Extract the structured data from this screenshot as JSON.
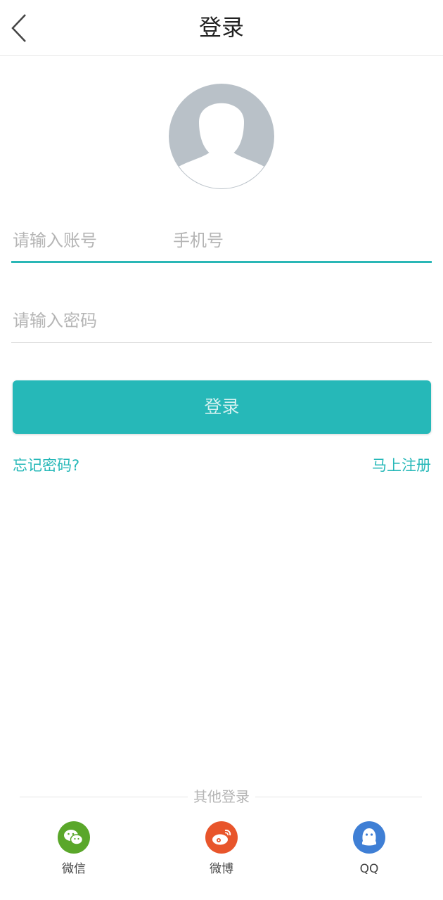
{
  "header": {
    "title": "登录",
    "back_icon": "chevron-left-icon"
  },
  "avatar": {
    "icon": "default-user-avatar-icon"
  },
  "account": {
    "placeholder": "请输入账号",
    "hint": "手机号"
  },
  "password": {
    "placeholder": "请输入密码"
  },
  "login_button": "登录",
  "links": {
    "forgot": "忘记密码?",
    "register": "马上注册"
  },
  "other_login": {
    "title": "其他登录",
    "options": [
      {
        "label": "微信",
        "icon": "wechat-icon",
        "color": "#5aa72a"
      },
      {
        "label": "微博",
        "icon": "weibo-icon",
        "color": "#e8552b"
      },
      {
        "label": "QQ",
        "icon": "qq-icon",
        "color": "#3f7fd5"
      }
    ]
  },
  "colors": {
    "accent": "#26b8b8"
  }
}
